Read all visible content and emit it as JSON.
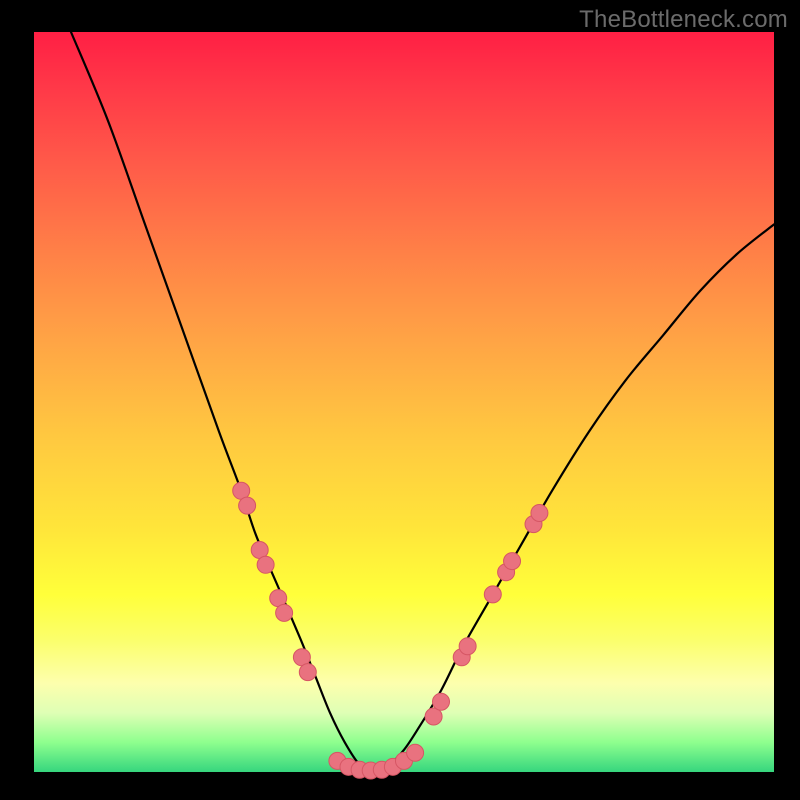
{
  "watermark": "TheBottleneck.com",
  "colors": {
    "frame": "#000000",
    "watermark": "#6b6b6b",
    "curve": "#000000",
    "dot_fill": "#e9727f",
    "dot_stroke": "#d65664"
  },
  "chart_data": {
    "type": "line",
    "title": "",
    "xlabel": "",
    "ylabel": "",
    "xlim": [
      0,
      100
    ],
    "ylim": [
      0,
      100
    ],
    "description": "V-shaped bottleneck curve. Y axis represents bottleneck percentage (0 = ideal at bottom, 100 = severe at top). X axis represents relative hardware balance. Minimum near x≈45.",
    "series": [
      {
        "name": "bottleneck-curve",
        "x": [
          5,
          10,
          15,
          20,
          25,
          28,
          30,
          33,
          36,
          38,
          40,
          42,
          44,
          46,
          48,
          50,
          52,
          55,
          58,
          62,
          66,
          70,
          75,
          80,
          85,
          90,
          95,
          100
        ],
        "y": [
          100,
          88,
          74,
          60,
          46,
          38,
          32,
          25,
          18,
          13,
          8,
          4,
          1,
          0,
          1,
          3,
          6,
          11,
          17,
          24,
          31,
          38,
          46,
          53,
          59,
          65,
          70,
          74
        ]
      }
    ],
    "markers": {
      "name": "sample-points",
      "comment": "Pink dots clustered along both flanks of the V and across the flat bottom.",
      "points": [
        {
          "x": 28.0,
          "y": 38.0
        },
        {
          "x": 28.8,
          "y": 36.0
        },
        {
          "x": 30.5,
          "y": 30.0
        },
        {
          "x": 31.3,
          "y": 28.0
        },
        {
          "x": 33.0,
          "y": 23.5
        },
        {
          "x": 33.8,
          "y": 21.5
        },
        {
          "x": 36.2,
          "y": 15.5
        },
        {
          "x": 37.0,
          "y": 13.5
        },
        {
          "x": 41.0,
          "y": 1.5
        },
        {
          "x": 42.5,
          "y": 0.7
        },
        {
          "x": 44.0,
          "y": 0.3
        },
        {
          "x": 45.5,
          "y": 0.2
        },
        {
          "x": 47.0,
          "y": 0.3
        },
        {
          "x": 48.5,
          "y": 0.7
        },
        {
          "x": 50.0,
          "y": 1.5
        },
        {
          "x": 51.5,
          "y": 2.6
        },
        {
          "x": 54.0,
          "y": 7.5
        },
        {
          "x": 55.0,
          "y": 9.5
        },
        {
          "x": 57.8,
          "y": 15.5
        },
        {
          "x": 58.6,
          "y": 17.0
        },
        {
          "x": 62.0,
          "y": 24.0
        },
        {
          "x": 63.8,
          "y": 27.0
        },
        {
          "x": 64.6,
          "y": 28.5
        },
        {
          "x": 67.5,
          "y": 33.5
        },
        {
          "x": 68.3,
          "y": 35.0
        }
      ]
    },
    "background_gradient": {
      "stops": [
        {
          "pct": 0,
          "color": "#ff1f44"
        },
        {
          "pct": 50,
          "color": "#ffd43b"
        },
        {
          "pct": 90,
          "color": "#fcffbf"
        },
        {
          "pct": 100,
          "color": "#36d67e"
        }
      ],
      "bottom_stripes": true
    }
  }
}
